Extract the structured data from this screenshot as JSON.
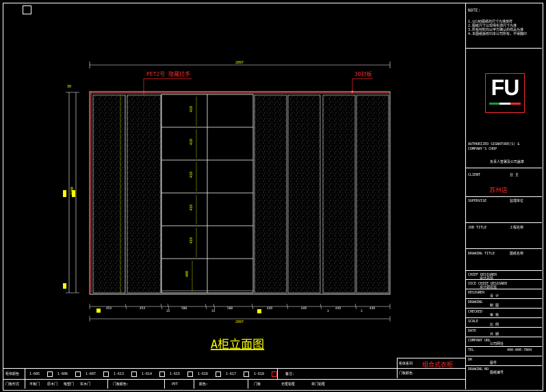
{
  "drawing": {
    "title": "A柜立面图",
    "top_dimension": "2897",
    "bottom_dimension": "2897",
    "height_dimension": "2400",
    "top_offset": "30",
    "callout_left": "PET2号 隐藏拉手",
    "callout_right": "30封板",
    "shelf_dims": [
      "410",
      "410",
      "410",
      "410",
      "410",
      "400"
    ],
    "bottom_dims": [
      "454",
      "454",
      "35",
      "500",
      "35",
      "500",
      "449",
      "449",
      "3",
      "449",
      "3",
      "449"
    ]
  },
  "title_block": {
    "note_header": "NOTE:",
    "notes": [
      "1.以CAD图纸的尺寸为准放样",
      "2.图纸尺寸以现场实测尺寸为准",
      "3.所有材料均以甲方确认的样品为准",
      "4.本图纸版权归本公司所有，不得翻印"
    ],
    "logo": "FU",
    "authorized": "AUTHORIZED SIGNATURE(S) & COMPANY'S CHOP",
    "authorized_cn": "负责人签署及公司盖章",
    "client_label": "CLIENT",
    "client_value": "业  主",
    "client_name": "苏州店",
    "supervise_label": "SUPERVISE",
    "supervise_value": "监理单位",
    "job_title_label": "JOB TITLE",
    "job_title_value": "工程名称",
    "drawing_title_label": "DRAWING TITLE",
    "drawing_title_value": "图纸名称",
    "rows": [
      {
        "en": "CHIEF DESIGNER",
        "cn": "设计总监"
      },
      {
        "en": "VICE CHIEF DESIGNER",
        "cn": "设计副总监"
      },
      {
        "en": "DESIGNER",
        "cn": "设  计"
      },
      {
        "en": "DRAWING",
        "cn": "制  图"
      },
      {
        "en": "CHECKED",
        "cn": "审  核"
      },
      {
        "en": "SCALE",
        "cn": "比  例"
      },
      {
        "en": "DATE",
        "cn": "日  期"
      },
      {
        "en": "COMPANY URL",
        "cn": "公司网址"
      },
      {
        "en": "TEL",
        "cn": "400-000-7804"
      },
      {
        "en": "DR",
        "cn": "图号"
      },
      {
        "en": "DRAWING NO",
        "cn": "图纸编号"
      }
    ]
  },
  "bottom_bar": {
    "row1_label": "柜体颜色",
    "row1_items": [
      "1-605",
      "1-606",
      "1-607",
      "1-613",
      "1-614",
      "1-615",
      "1-616",
      "1-617",
      "1-618"
    ],
    "row1_extra": "备注:",
    "series_label": "柜体系列",
    "series_value": "组合式衣柜",
    "row2_items": [
      "门板形式",
      "平板门",
      "原木门",
      "吸塑门",
      "实木门",
      "门板颜色:",
      "PET",
      "颜色:",
      "门板",
      "无框铝框",
      "单门铝框"
    ],
    "door_label": "门板颜色",
    "door_value": "原木色"
  }
}
